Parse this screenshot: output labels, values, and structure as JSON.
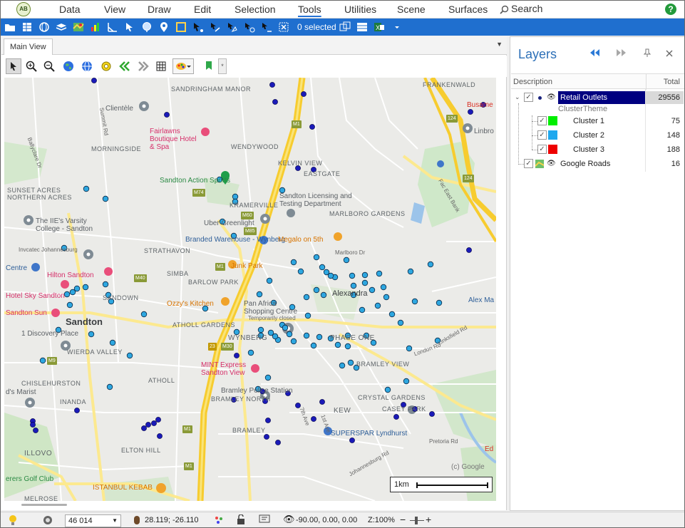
{
  "menu": {
    "app_logo": "AB",
    "items": [
      {
        "label": "Data"
      },
      {
        "label": "View"
      },
      {
        "label": "Draw"
      },
      {
        "label": "Edit"
      },
      {
        "label": "Selection"
      },
      {
        "label": "Tools",
        "active": true
      },
      {
        "label": "Utilities"
      },
      {
        "label": "Scene"
      },
      {
        "label": "Surfaces"
      }
    ],
    "search_label": "Search",
    "help_label": "?"
  },
  "toolbar": {
    "selected_text": "0 selected",
    "accent_color": "#1f6fcf"
  },
  "tabs": {
    "main_view_label": "Main View"
  },
  "map_toolbar": {
    "buttons": [
      "select-arrow-icon",
      "zoom-in-icon",
      "zoom-out-icon",
      "globe-icon",
      "globe-grid-icon",
      "gear-icon",
      "pan-back-icon",
      "pan-forward-icon",
      "grid-icon",
      "palette-icon",
      "marker-icon"
    ]
  },
  "map": {
    "area_labels": [
      "MORNINGSIDE",
      "SUNSET ACRES",
      "NORTHERN ACRES",
      "STRATHAVON",
      "SIMBA",
      "BARLOW PARK",
      "SANDOWN",
      "WIERDA VALLEY",
      "CHISLEHURSTON",
      "INANDA",
      "ILLOVO",
      "ATHOLL",
      "ATHOLL GARDENS",
      "WYNBERG",
      "PHASE ONE",
      "BRAMLEY VIEW",
      "CRYSTAL GARDENS",
      "CASEY PARK",
      "KEW",
      "BRAMLEY",
      "ELTON HILL",
      "MELROSE",
      "MARLBORO GARDENS",
      "EASTGATE",
      "KELVIN VIEW",
      "WENDYWOOD",
      "SANDRINGHAM MANOR",
      "KRAMERVILLE",
      "BRAMLEY NORTH",
      "FRANKENWALD"
    ],
    "suburb_labels": [
      "Sandton",
      "Alexandra"
    ],
    "poi_labels": {
      "clientele": "Clientèle",
      "fairlawns": "Fairlawns Boutique Hotel & Spa",
      "busamed": "Busame",
      "linbro": "Linbro",
      "sandton_action_sports": "Sandton Action Sports",
      "licensing": "Sandton Licensing and Testing Department",
      "uber_greenlight": "Uber Greenlight",
      "iies_varsity": "The IIE's Varsity College - Sandton",
      "invectec": "Invcatec Johannesburg",
      "branded_warehouse": "Branded Warehouse - Wynberg",
      "megalo": "Megalo on 5th",
      "centre": "Centre",
      "hilton": "Hilton Sandton",
      "junk_park": "Junk Park",
      "sky_sandton": "Hotel Sky Sandton",
      "sandton_sun": "Sandton Sun",
      "ozzys": "Ozzy's Kitchen",
      "pan_africa": "Pan Africa Shopping Centre",
      "temporarily_closed": "Temporarily closed",
      "alex_mall": "Alex Ma",
      "discovery": "1 Discovery Place",
      "mint_express": "MINT Express Sandton View",
      "marist": "d's Marist",
      "bramley_police": "Bramley Police Station",
      "superspar": "SUPERSPAR Lyndhurst",
      "golf_club": "erers Golf Club",
      "istanbul_kebab": "ISTANBUL KEBAB",
      "ed": "Ed"
    },
    "street_labels": [
      "Summit Rd",
      "London Rd",
      "Pretoria Rd",
      "Fac East Bank",
      "Ballyclare Dr",
      "Johannesburg Rd",
      "Linksfield Rd",
      "7th Ave",
      "1st Ave",
      "Marlboro Dr"
    ],
    "shields": [
      "M1",
      "M74",
      "M85",
      "M60",
      "M40",
      "M9",
      "M30",
      "M1",
      "124",
      "124",
      "23",
      "M1",
      "M1"
    ],
    "copyright": "(c) Google",
    "scale_label": "1km"
  },
  "layers": {
    "title": "Layers",
    "header_description": "Description",
    "header_total": "Total",
    "root": {
      "name": "Retail Outlets",
      "total": "29556"
    },
    "theme_label": "ClusterTheme",
    "clusters": [
      {
        "name": "Cluster 1",
        "total": "75",
        "color": "#00ee00"
      },
      {
        "name": "Cluster 2",
        "total": "148",
        "color": "#1fa8ee"
      },
      {
        "name": "Cluster 3",
        "total": "188",
        "color": "#ee0000"
      }
    ],
    "google_roads": {
      "name": "Google Roads",
      "total": "16"
    },
    "selection_color": "#000080"
  },
  "statusbar": {
    "scale_value": "46 014",
    "coordinates": "28.119; -26.110",
    "orientation": "-90.00, 0.00, 0.00",
    "zoom": "Z:100%"
  }
}
